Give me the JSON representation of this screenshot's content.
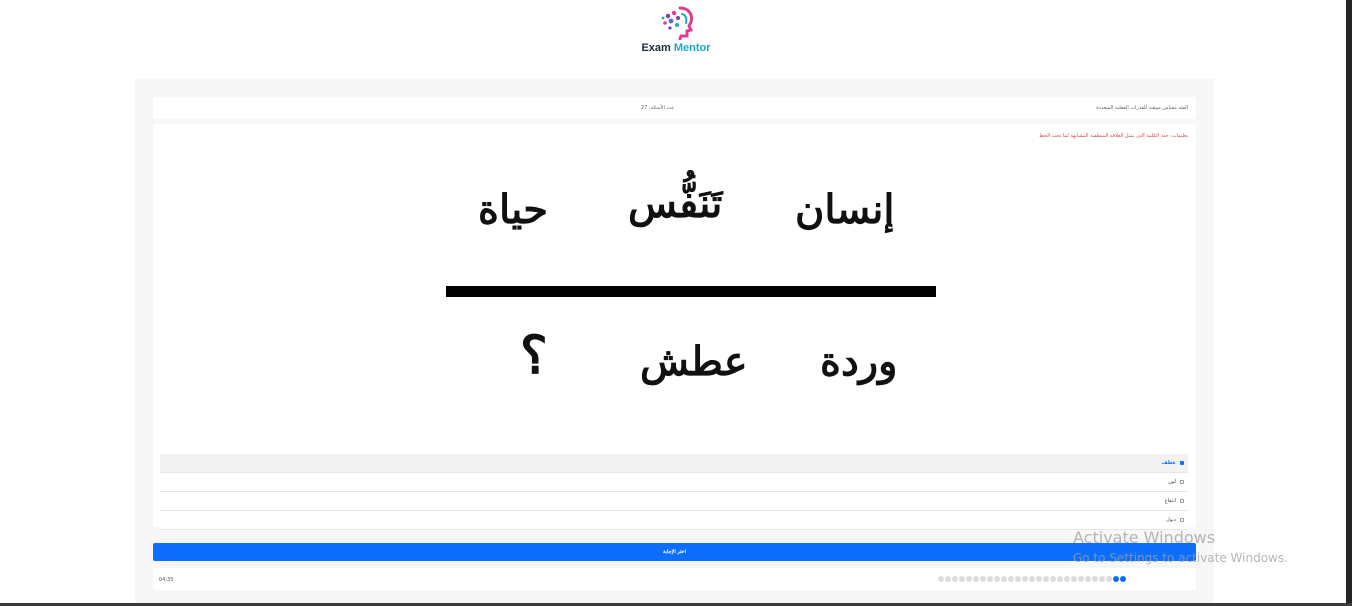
{
  "brand": {
    "logo_icon": "head-with-dots-icon",
    "name_part1": "Exam",
    "name_part2": "Mentor",
    "colors": {
      "dark": "#1f2a44",
      "teal": "#1aa9c9",
      "pink": "#e23c8f",
      "purple": "#7b3fb8"
    }
  },
  "exam": {
    "title": "الفئة مقياس موهبة للقدرات العقلية المتعددة",
    "question_count": "عدد الأسئلة: 27"
  },
  "question": {
    "instructions": "تعليمات: حدد الكلمة التي تمثل العلاقة المنطقية المشابهة لما تحت الخط",
    "top_words": [
      "إنسان",
      "تَنَفُّس",
      "حياة"
    ],
    "bottom_words": [
      "وردة",
      "عطش",
      "؟"
    ]
  },
  "options": [
    {
      "label": "عطف",
      "selected": true
    },
    {
      "label": "لون",
      "selected": false
    },
    {
      "label": "انتقاع",
      "selected": false
    },
    {
      "label": "ذبول",
      "selected": false
    }
  ],
  "actions": {
    "choose_label": "اختر الإجابة"
  },
  "progress": {
    "timer": "04:35",
    "total": 27,
    "completed": 2,
    "accent_color": "#0d6efd"
  },
  "watermark": {
    "title": "Activate Windows",
    "subtitle": "Go to Settings to activate Windows."
  }
}
